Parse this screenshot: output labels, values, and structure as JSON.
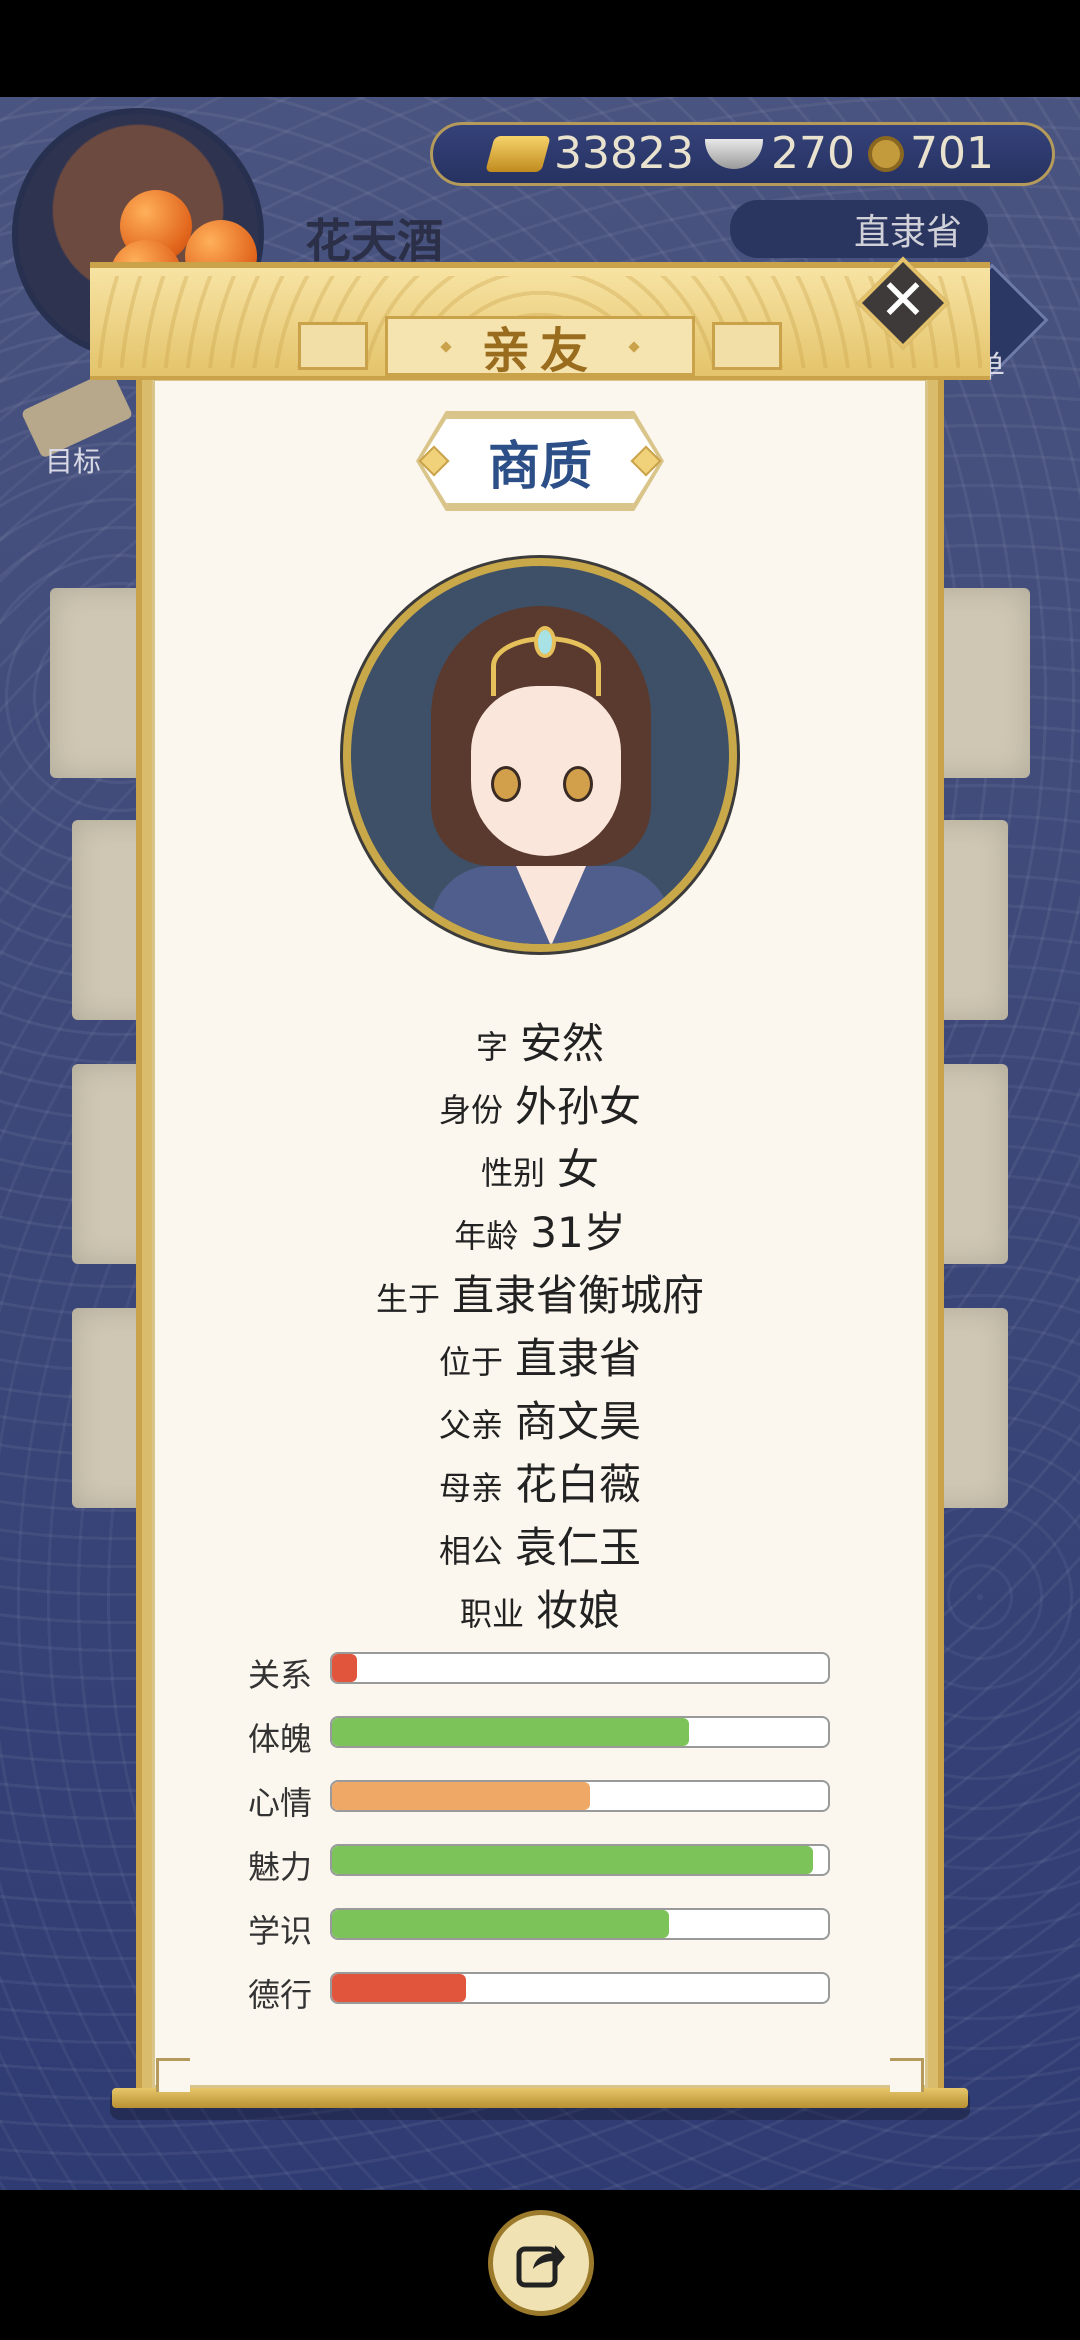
{
  "header": {
    "player_name": "花天酒",
    "province": "直隶省",
    "menu_label": "菜单",
    "goal_label": "目标",
    "resources": {
      "gold": "33823",
      "silver": "270",
      "coin": "701"
    }
  },
  "modal": {
    "title": "亲友",
    "person_name": "商质",
    "info": [
      {
        "key": "字",
        "value": "安然"
      },
      {
        "key": "身份",
        "value": "外孙女"
      },
      {
        "key": "性别",
        "value": "女"
      },
      {
        "key": "年龄",
        "value": "31岁"
      },
      {
        "key": "生于",
        "value": "直隶省衡城府"
      },
      {
        "key": "位于",
        "value": "直隶省"
      },
      {
        "key": "父亲",
        "value": "商文昊"
      },
      {
        "key": "母亲",
        "value": "花白薇"
      },
      {
        "key": "相公",
        "value": "袁仁玉"
      },
      {
        "key": "职业",
        "value": "妆娘"
      }
    ],
    "stats": [
      {
        "label": "关系",
        "fraction": 0.05,
        "color": "#e0553c"
      },
      {
        "label": "体魄",
        "fraction": 0.72,
        "color": "#7cc35a"
      },
      {
        "label": "心情",
        "fraction": 0.52,
        "color": "#f0a866"
      },
      {
        "label": "魅力",
        "fraction": 0.97,
        "color": "#7cc35a"
      },
      {
        "label": "学识",
        "fraction": 0.68,
        "color": "#7cc35a"
      },
      {
        "label": "德行",
        "fraction": 0.27,
        "color": "#e0553c"
      }
    ]
  }
}
